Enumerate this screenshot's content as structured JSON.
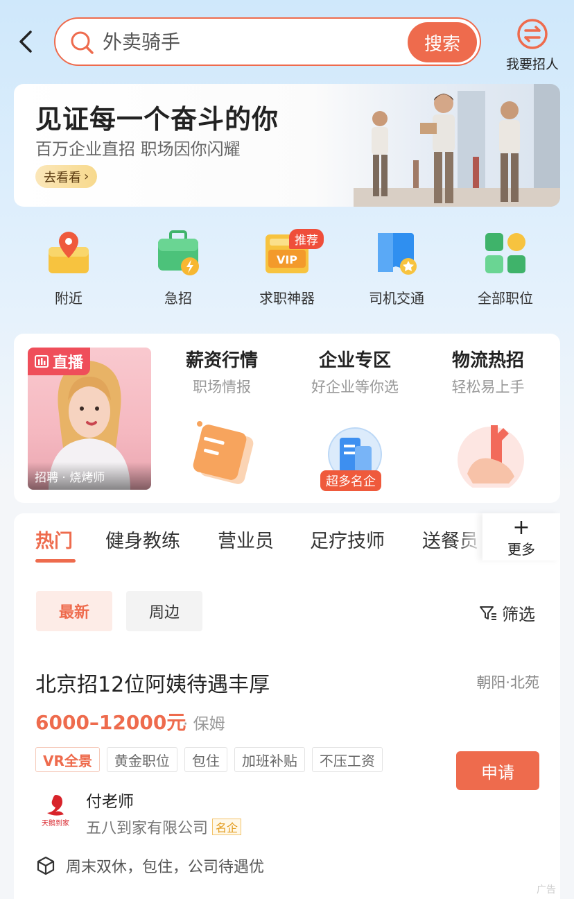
{
  "header": {
    "search_query": "外卖骑手",
    "search_button": "搜索",
    "recruit_label": "我要招人"
  },
  "banner": {
    "title": "见证每一个奋斗的你",
    "subtitle": "百万企业直招 职场因你闪耀",
    "button": "去看看"
  },
  "categories": [
    {
      "label": "附近",
      "icon": "location-map-icon"
    },
    {
      "label": "急招",
      "icon": "urgent-briefcase-icon"
    },
    {
      "label": "求职神器",
      "icon": "vip-card-icon",
      "badge": "推荐"
    },
    {
      "label": "司机交通",
      "icon": "map-book-icon"
    },
    {
      "label": "全部职位",
      "icon": "grid-apps-icon"
    }
  ],
  "features": {
    "live": {
      "badge": "直播",
      "caption": "招聘 · 烧烤师"
    },
    "items": [
      {
        "title": "薪资行情",
        "subtitle": "职场情报"
      },
      {
        "title": "企业专区",
        "subtitle": "好企业等你选",
        "tag": "超多名企"
      },
      {
        "title": "物流热招",
        "subtitle": "轻松易上手"
      }
    ]
  },
  "tabs": {
    "items": [
      "热门",
      "健身教练",
      "营业员",
      "足疗技师",
      "送餐员"
    ],
    "active_index": 0,
    "more_label": "更多"
  },
  "filters": {
    "chips": [
      "最新",
      "周边"
    ],
    "filter_label": "筛选"
  },
  "job": {
    "title": "北京招12位阿姨待遇丰厚",
    "location": "朝阳·北苑",
    "salary": "6000–12000元",
    "type": "· 保姆",
    "tags": [
      "VR全景",
      "黄金职位",
      "包住",
      "加班补贴",
      "不压工资"
    ],
    "apply_label": "申请",
    "recruiter": "付老师",
    "company": "五八到家有限公司",
    "company_badge": "名企",
    "logo_text": "天鹅到家",
    "benefits": "周末双休，包住，公司待遇优",
    "ad_label": "广告"
  },
  "colors": {
    "accent": "#ee6b4d",
    "badge_red": "#ef4e3a"
  }
}
